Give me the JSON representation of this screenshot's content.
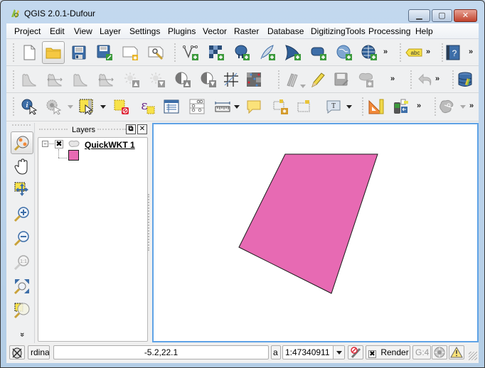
{
  "window": {
    "title": "QGIS 2.0.1-Dufour",
    "controls": {
      "minimize": "minimize",
      "maximize": "maximize",
      "close": "close"
    }
  },
  "menubar": {
    "items": [
      "Project",
      "Edit",
      "View",
      "Layer",
      "Settings",
      "Plugins",
      "Vector",
      "Raster",
      "Database",
      "DigitizingTools",
      "Processing",
      "Help"
    ]
  },
  "toolbars": {
    "file": [
      "new-project",
      "open-project",
      "save-project",
      "save-project-as",
      "new-print-composer",
      "composer-manager"
    ],
    "add_layers": [
      "add-vector-layer",
      "add-raster-layer",
      "add-postgis-layer",
      "add-spatialite-layer",
      "add-mssql-layer",
      "add-oracle-layer",
      "add-wms-layer",
      "add-wcs-layer"
    ],
    "labels": [
      "labeling"
    ],
    "help": [
      "whats-this-help"
    ],
    "raster": [
      "local-histogram-stretch",
      "full-histogram-stretch",
      "local-cumulative-stretch",
      "full-cumulative-stretch",
      "increase-brightness",
      "decrease-brightness",
      "increase-contrast",
      "decrease-contrast"
    ],
    "raster2": [
      "grid-tool",
      "georeferencer"
    ],
    "digitizing": [
      "current-edits",
      "toggle-editing",
      "save-layer-edits",
      "add-feature"
    ],
    "undo": [
      "undo"
    ],
    "database": [
      "db-manager"
    ],
    "attributes": [
      "identify-features",
      "run-feature-action",
      "select-features",
      "deselect-all",
      "select-by-expression",
      "open-attribute-table",
      "open-field-calculator",
      "measure-line"
    ],
    "annotations": [
      "text-annotation",
      "form-annotation",
      "move-annotation",
      "text-annotation-dropdown"
    ],
    "plugins": [
      "geometry-tools",
      "gps-tools"
    ],
    "advanced": [
      "split-features"
    ],
    "overflow_label": "»"
  },
  "map_navigation": {
    "tools": [
      "pan-map",
      "pan-to-selection",
      "zoom-in",
      "zoom-out",
      "zoom-native",
      "zoom-full",
      "zoom-to-layer"
    ],
    "overflow_label": "»"
  },
  "layers_panel": {
    "title": "Layers",
    "layers": [
      {
        "name": "QuickWKT 1",
        "visible": true,
        "fill_color": "#e76ab3",
        "stroke_color": "#1a1a1a"
      }
    ]
  },
  "map": {
    "background": "#ffffff",
    "features": [
      {
        "type": "polygon",
        "fill": "#e76ab3",
        "stroke": "#1a1a1a"
      }
    ]
  },
  "statusbar": {
    "coordinate_label": "rdina",
    "coordinate_value": "-5.2,22.1",
    "scale_label": "a",
    "scale_value": "1:47340911",
    "render_label": "Render",
    "render_checked": true,
    "crs_label": "G:4"
  }
}
